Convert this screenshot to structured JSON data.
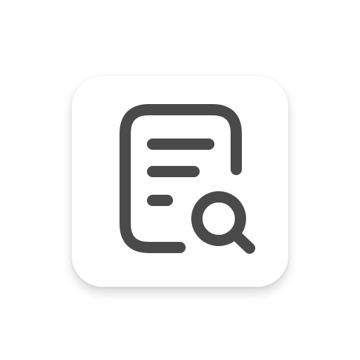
{
  "app_icon": {
    "icon": "document-search-icon",
    "tile_color": "#ffffff",
    "glyph_color": "#4a4a4a"
  }
}
